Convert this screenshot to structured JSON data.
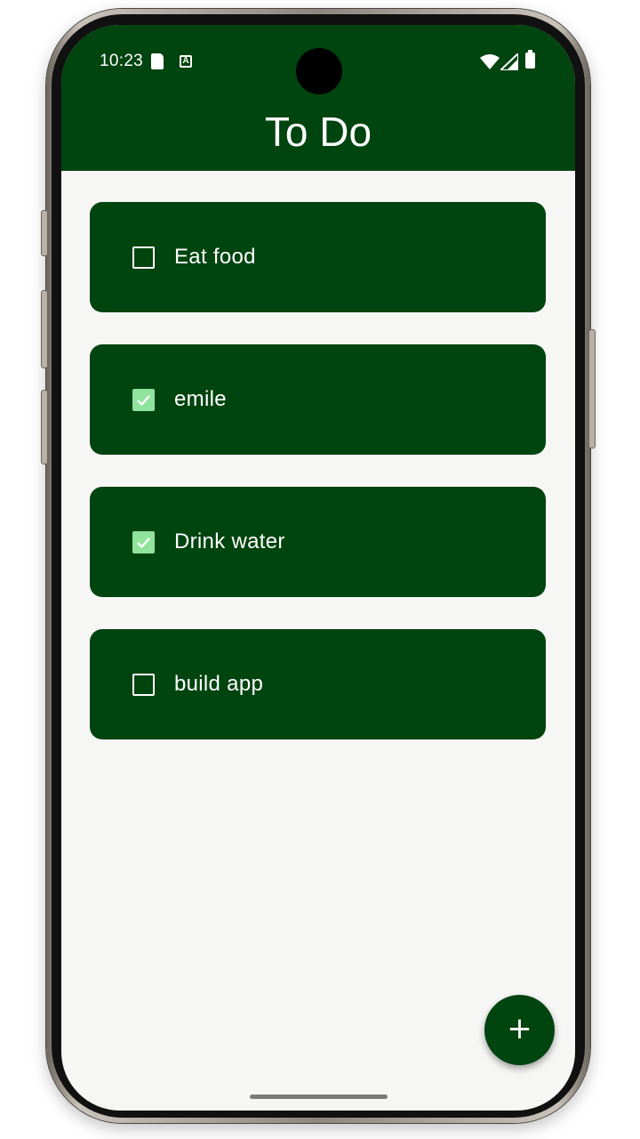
{
  "colors": {
    "accent": "#00440f",
    "checked_fill": "#90e39c",
    "background": "#f6f6f5"
  },
  "status_bar": {
    "time": "10:23",
    "icons": [
      "sd-card-icon",
      "text-a-icon",
      "wifi-icon",
      "signal-icon",
      "battery-icon"
    ]
  },
  "app_bar": {
    "title": "To Do"
  },
  "todos": [
    {
      "label": "Eat food",
      "checked": false
    },
    {
      "label": "emile",
      "checked": true
    },
    {
      "label": "Drink water",
      "checked": true
    },
    {
      "label": "build app",
      "checked": false
    }
  ],
  "fab": {
    "icon": "+"
  }
}
